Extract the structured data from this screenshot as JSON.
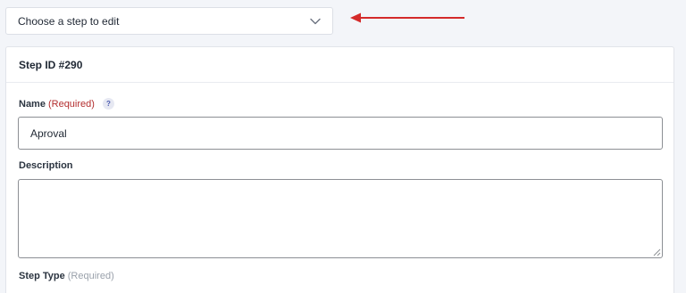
{
  "step_selector": {
    "label": "Choose a step to edit",
    "icon": "chevron-down-icon"
  },
  "annotation": {
    "icon": "arrow-left-icon",
    "color": "#d42a2a"
  },
  "card": {
    "title": "Step ID #290"
  },
  "fields": {
    "name": {
      "label": "Name",
      "required": "(Required)",
      "help": "?",
      "value": "Aproval"
    },
    "description": {
      "label": "Description",
      "value": ""
    },
    "step_type": {
      "label": "Step Type",
      "required": "(Required)"
    }
  },
  "colors": {
    "required": "#b32d2e",
    "required_muted": "#9aa1ab",
    "background": "#f3f5f9"
  }
}
